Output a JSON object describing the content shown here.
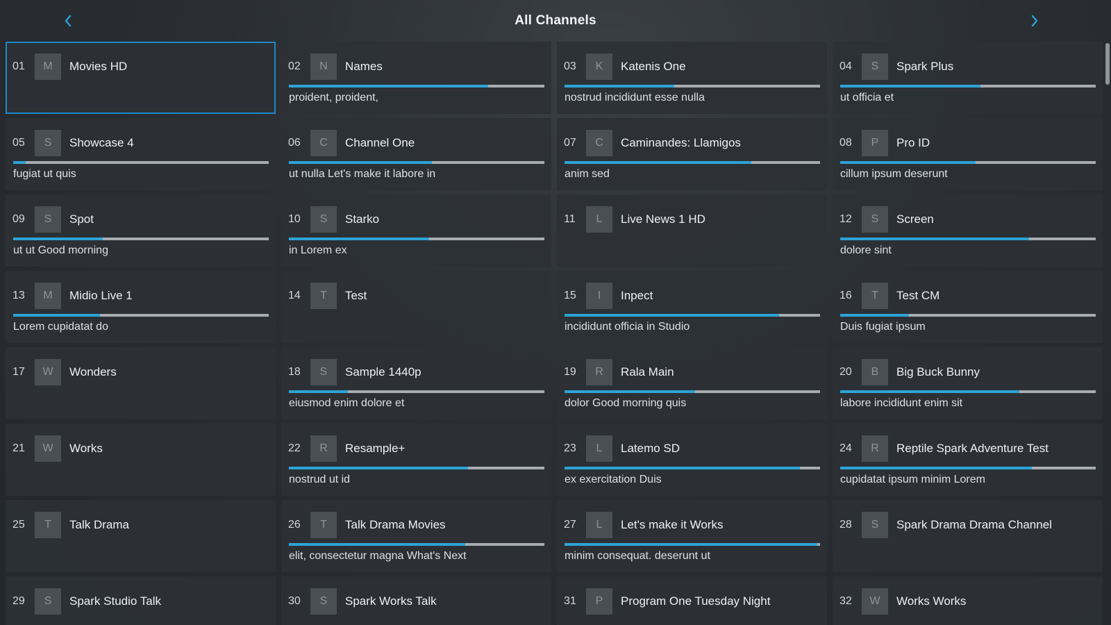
{
  "header": {
    "title": "All Channels",
    "prev_icon": "chevron-left-icon",
    "next_icon": "chevron-right-icon"
  },
  "colors": {
    "accent": "#2da3d6",
    "selected_border": "#1e88c9",
    "background": "#23272b",
    "card": "#2d3135"
  },
  "channels": [
    {
      "number": "01",
      "logo": "M",
      "name": "Movies HD",
      "program": "",
      "progress": null,
      "selected": true
    },
    {
      "number": "02",
      "logo": "N",
      "name": "Names",
      "program": "proident, proident,",
      "progress": 0.78
    },
    {
      "number": "03",
      "logo": "K",
      "name": "Katenis One",
      "program": "nostrud incididunt esse nulla",
      "progress": 0.43
    },
    {
      "number": "04",
      "logo": "S",
      "name": "Spark Plus",
      "program": "ut officia et",
      "progress": 0.55
    },
    {
      "number": "05",
      "logo": "S",
      "name": "Showcase 4",
      "program": "fugiat ut quis",
      "progress": 0.05
    },
    {
      "number": "06",
      "logo": "C",
      "name": "Channel One",
      "program": "ut nulla Let's make it labore in",
      "progress": 0.56
    },
    {
      "number": "07",
      "logo": "C",
      "name": "Caminandes: Llamigos",
      "program": "anim sed",
      "progress": 0.73
    },
    {
      "number": "08",
      "logo": "P",
      "name": "Pro ID",
      "program": "cillum ipsum deserunt",
      "progress": 0.53
    },
    {
      "number": "09",
      "logo": "S",
      "name": "Spot",
      "program": "ut ut Good morning",
      "progress": 0.35
    },
    {
      "number": "10",
      "logo": "S",
      "name": "Starko",
      "program": "in Lorem ex",
      "progress": 0.55
    },
    {
      "number": "11",
      "logo": "L",
      "name": "Live News 1 HD",
      "program": "",
      "progress": null
    },
    {
      "number": "12",
      "logo": "S",
      "name": "Screen",
      "program": "dolore sint",
      "progress": 0.74
    },
    {
      "number": "13",
      "logo": "M",
      "name": "Midio Live 1",
      "program": "Lorem cupidatat do",
      "progress": 0.34
    },
    {
      "number": "14",
      "logo": "T",
      "name": "Test",
      "program": "",
      "progress": null
    },
    {
      "number": "15",
      "logo": "I",
      "name": "Inpect",
      "program": "incididunt officia in Studio",
      "progress": 0.84
    },
    {
      "number": "16",
      "logo": "T",
      "name": "Test CM",
      "program": "Duis fugiat ipsum",
      "progress": 0.27
    },
    {
      "number": "17",
      "logo": "W",
      "name": "Wonders",
      "program": "",
      "progress": null
    },
    {
      "number": "18",
      "logo": "S",
      "name": "Sample 1440p",
      "program": "eiusmod enim dolore et",
      "progress": 0.23
    },
    {
      "number": "19",
      "logo": "R",
      "name": "Rala Main",
      "program": "dolor Good morning quis",
      "progress": 0.51
    },
    {
      "number": "20",
      "logo": "B",
      "name": "Big Buck Bunny",
      "program": "labore incididunt enim sit",
      "progress": 0.7
    },
    {
      "number": "21",
      "logo": "W",
      "name": "Works",
      "program": "",
      "progress": null
    },
    {
      "number": "22",
      "logo": "R",
      "name": "Resample+",
      "program": "nostrud ut id",
      "progress": 0.7
    },
    {
      "number": "23",
      "logo": "L",
      "name": "Latemo SD",
      "program": "ex exercitation Duis",
      "progress": 0.92
    },
    {
      "number": "24",
      "logo": "R",
      "name": "Reptile Spark Adventure Test",
      "program": "cupidatat ipsum minim Lorem",
      "progress": 0.75
    },
    {
      "number": "25",
      "logo": "T",
      "name": "Talk Drama",
      "program": "",
      "progress": null
    },
    {
      "number": "26",
      "logo": "T",
      "name": "Talk Drama Movies",
      "program": "elit, consectetur magna What's Next",
      "progress": 0.69
    },
    {
      "number": "27",
      "logo": "L",
      "name": "Let's make it Works",
      "program": "minim consequat. deserunt ut",
      "progress": 0.99
    },
    {
      "number": "28",
      "logo": "S",
      "name": "Spark Drama Drama Channel",
      "program": "",
      "progress": null
    },
    {
      "number": "29",
      "logo": "S",
      "name": "Spark Studio Talk",
      "program": "",
      "progress": null
    },
    {
      "number": "30",
      "logo": "S",
      "name": "Spark Works Talk",
      "program": "",
      "progress": null
    },
    {
      "number": "31",
      "logo": "P",
      "name": "Program One Tuesday Night",
      "program": "",
      "progress": null
    },
    {
      "number": "32",
      "logo": "W",
      "name": "Works Works",
      "program": "",
      "progress": null
    }
  ]
}
